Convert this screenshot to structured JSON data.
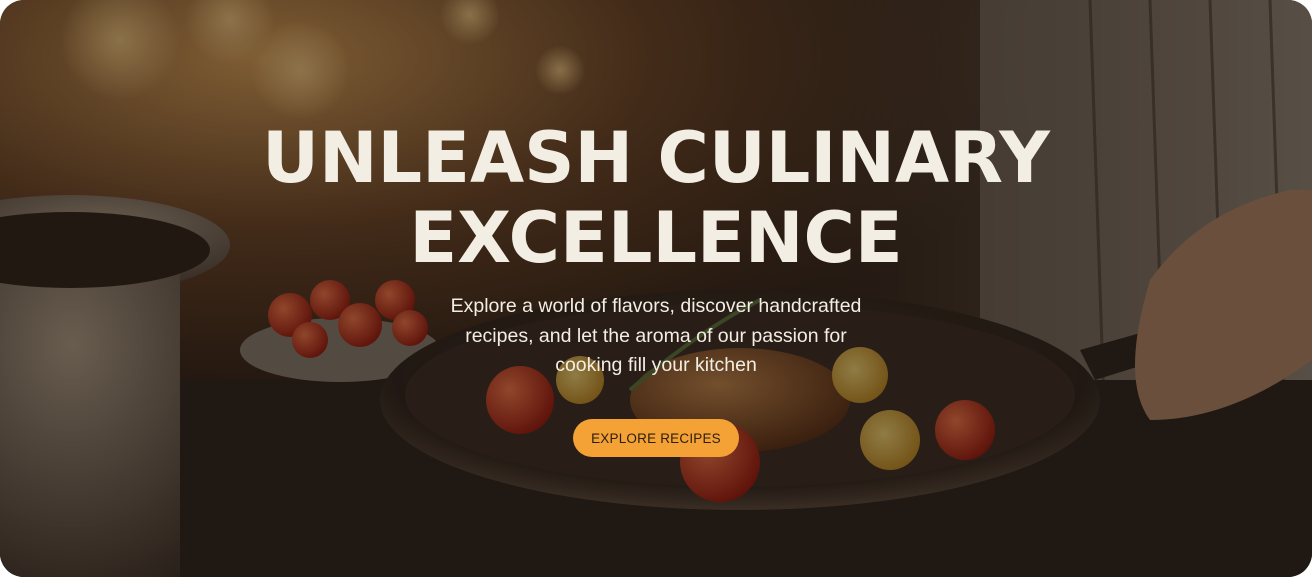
{
  "hero": {
    "title_line1": "UNLEASH CULINARY",
    "title_line2": "EXCELLENCE",
    "subtitle": "Explore a world of flavors, discover handcrafted recipes, and let the aroma of our passion for cooking fill your kitchen",
    "cta_label": "EXPLORE RECIPES"
  },
  "colors": {
    "title_text": "#f3eee4",
    "cta_background": "#f4a236",
    "cta_text": "#2b1d10",
    "overlay": "rgba(20,14,10,0.48)"
  }
}
